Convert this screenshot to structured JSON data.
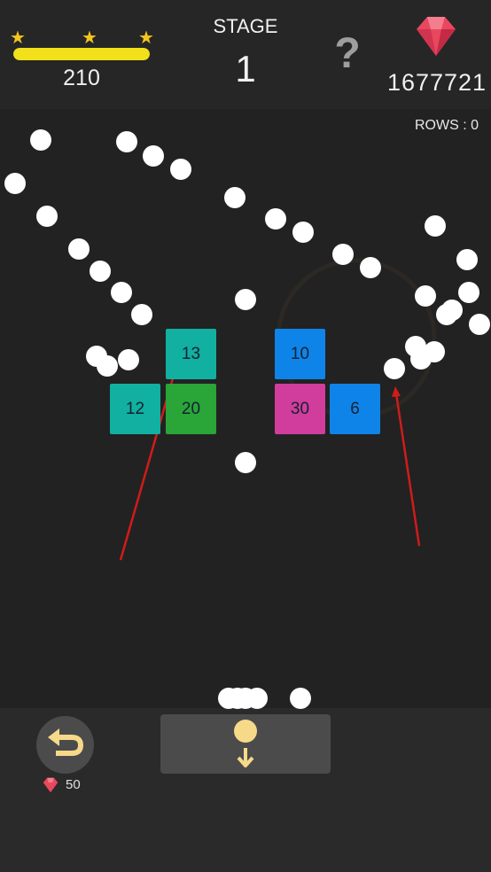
{
  "header": {
    "score": "210",
    "progress": 1.0,
    "stars": [
      "star-icon",
      "star-icon",
      "star-icon"
    ],
    "stage_label": "STAGE",
    "stage_number": "1",
    "help_icon": "?",
    "gem_count": "1677721"
  },
  "field": {
    "rows_label": "ROWS : 0"
  },
  "blocks": [
    {
      "value": "13",
      "color": "#11b0a0"
    },
    {
      "value": "12",
      "color": "#11b0a0"
    },
    {
      "value": "20",
      "color": "#2aa538"
    },
    {
      "value": "10",
      "color": "#0f84e8"
    },
    {
      "value": "30",
      "color": "#d13d9c"
    },
    {
      "value": "6",
      "color": "#0f84e8"
    }
  ],
  "footer": {
    "undo_cost": "50"
  },
  "colors": {
    "background": "#222222",
    "gem": "#e8485e",
    "arrow": "#d11b1b",
    "button_icon": "#f7d98a"
  }
}
